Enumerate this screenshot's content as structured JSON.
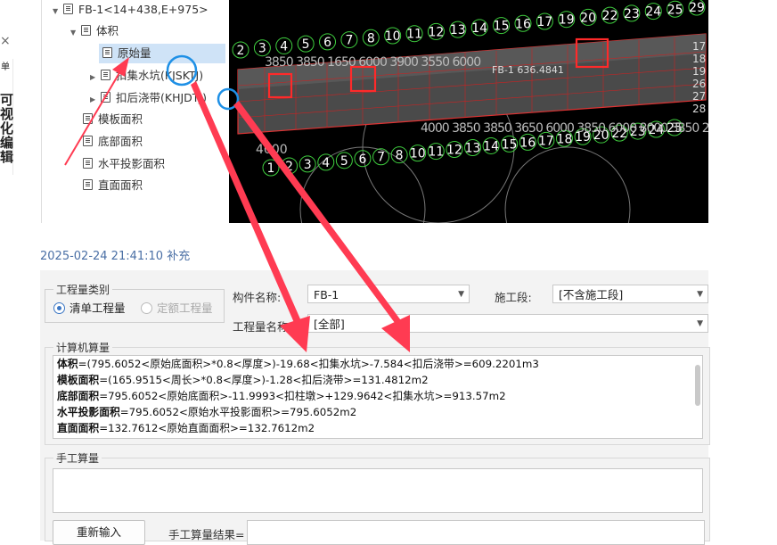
{
  "edge": {
    "close_glyph": "×",
    "tab_text": "单",
    "tab_bold": "可视化编辑"
  },
  "tree": {
    "root": "FB-1<14+438,E+975>",
    "volume": "体积",
    "original": "原始量",
    "deduct_pit": "扣集水坑(KJSKTJ)",
    "deduct_strip": "扣后浇带(KHJDTJ)",
    "formwork": "模板面积",
    "bottom": "底部面积",
    "horizontal": "水平投影面积",
    "vertical": "直面面积"
  },
  "cad": {
    "label": "FB-1 636.4841",
    "top_numbers": [
      "2",
      "3",
      "4",
      "5",
      "6",
      "7",
      "8",
      "10",
      "11",
      "12",
      "13",
      "14",
      "15",
      "16",
      "17",
      "19",
      "20",
      "22",
      "23",
      "24",
      "25",
      "29"
    ],
    "bottom_numbers": [
      "1",
      "2",
      "3",
      "4",
      "5",
      "6",
      "7",
      "8",
      "10",
      "11",
      "12",
      "13",
      "14",
      "15",
      "16",
      "17",
      "18",
      "19",
      "20",
      "22",
      "23",
      "24",
      "25"
    ],
    "dims_top": "3850 3850 1650 6000 3900 3550 6000",
    "dims_bottom": "4000 3850 3850 3650 6000 3850 6000 8000 3850 2650",
    "left_dim": "4000",
    "right_dims": [
      "17",
      "18",
      "19",
      "26",
      "27",
      "28"
    ]
  },
  "timestamp": "2025-02-24 21:41:10 补充",
  "form": {
    "quantity_type_title": "工程量类别",
    "radio_list": "清单工程量",
    "radio_quota": "定额工程量",
    "component_label": "构件名称:",
    "component_value": "FB-1",
    "stage_label": "施工段:",
    "stage_value": "[不含施工段]",
    "quantity_label": "工程量名称:",
    "quantity_value": "[全部]",
    "calc_title": "计算机算量",
    "calc_lines": [
      {
        "name": "体积",
        "expr": "=(795.6052<原始底面积>*0.8<厚度>)-19.68<扣集水坑>-7.584<扣后浇带>=609.2201m3"
      },
      {
        "name": "模板面积",
        "expr": "=(165.9515<周长>*0.8<厚度>)-1.28<扣后浇带>=131.4812m2"
      },
      {
        "name": "底部面积",
        "expr": "=795.6052<原始底面积>-11.9993<扣柱墩>+129.9642<扣集水坑>=913.57m2"
      },
      {
        "name": "水平投影面积",
        "expr": "=795.6052<原始水平投影面积>=795.6052m2"
      },
      {
        "name": "直面面积",
        "expr": "=132.7612<原始直面面积>=132.7612m2"
      }
    ],
    "manual_title": "手工算量",
    "reenter_button": "重新输入",
    "manual_result_label": "手工算量结果="
  },
  "colors": {
    "accent": "#3a76c4",
    "annotation_red": "#ff3b52",
    "annotation_blue": "#1e90e6",
    "selection": "#cfe3f7",
    "cad_green": "#3fcf3f",
    "cad_red": "#e02020"
  }
}
